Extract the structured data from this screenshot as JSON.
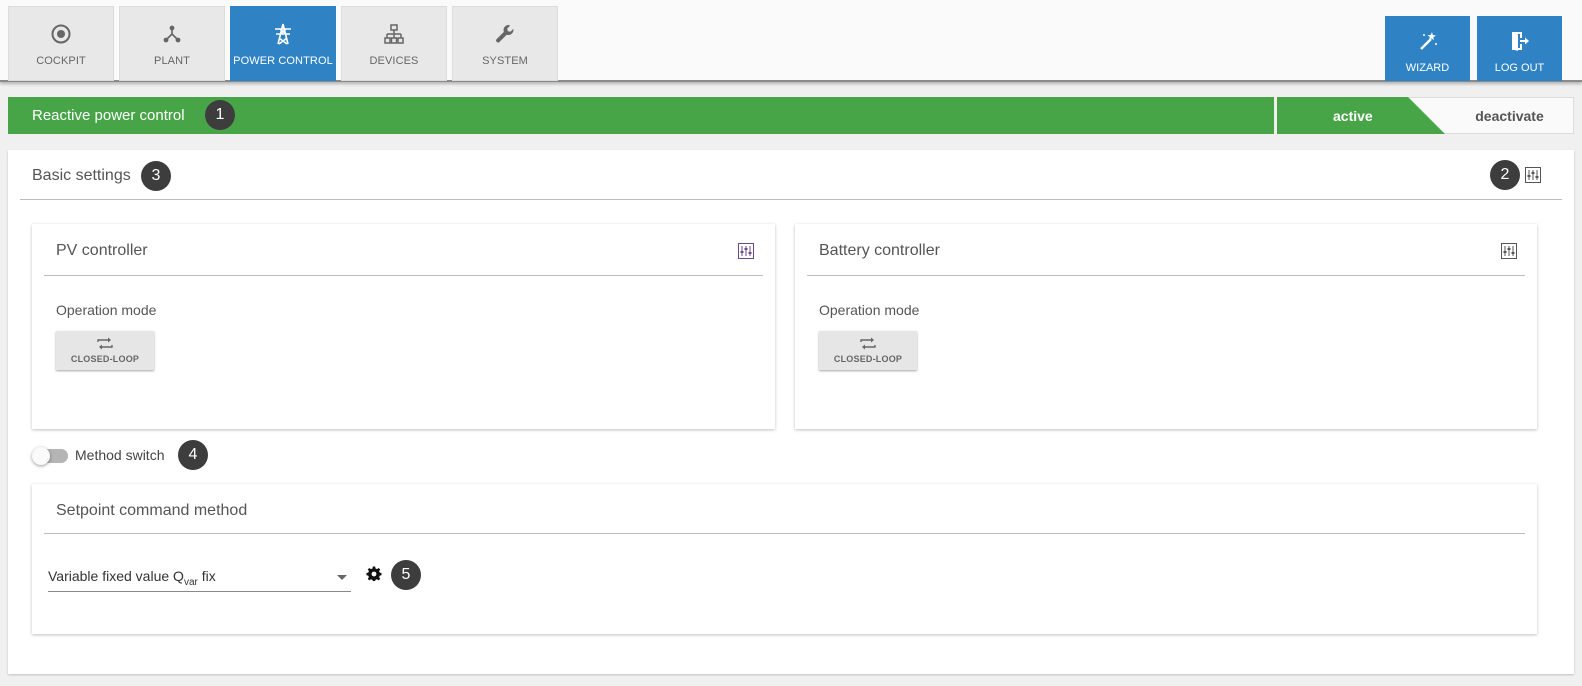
{
  "nav": {
    "tabs": [
      {
        "label": "COCKPIT",
        "icon": "target-icon"
      },
      {
        "label": "PLANT",
        "icon": "network-nodes-icon"
      },
      {
        "label": "POWER CONTROL",
        "icon": "power-tower-icon",
        "active": true
      },
      {
        "label": "DEVICES",
        "icon": "device-tree-icon"
      },
      {
        "label": "SYSTEM",
        "icon": "wrench-icon"
      }
    ],
    "actions": [
      {
        "label": "WIZARD",
        "icon": "magic-wand-icon"
      },
      {
        "label": "LOG OUT",
        "icon": "logout-icon"
      }
    ]
  },
  "status": {
    "title": "Reactive power control",
    "badge": "1",
    "active_label": "active",
    "deactivate_label": "deactivate"
  },
  "basic_settings": {
    "title": "Basic settings",
    "badge": "3",
    "settings_badge": "2"
  },
  "pv_controller": {
    "title": "PV controller",
    "op_label": "Operation mode",
    "mode_label": "CLOSED-LOOP"
  },
  "battery_controller": {
    "title": "Battery controller",
    "op_label": "Operation mode",
    "mode_label": "CLOSED-LOOP"
  },
  "method_switch": {
    "label": "Method switch",
    "badge": "4",
    "enabled": false
  },
  "setpoint": {
    "title": "Setpoint command method",
    "select_prefix": "Variable fixed value Q",
    "select_sub": "var",
    "select_suffix": " fix",
    "badge": "5"
  },
  "colors": {
    "accent_blue": "#2f83c4",
    "status_green": "#47a447",
    "badge_dark": "#3d3d3d"
  }
}
